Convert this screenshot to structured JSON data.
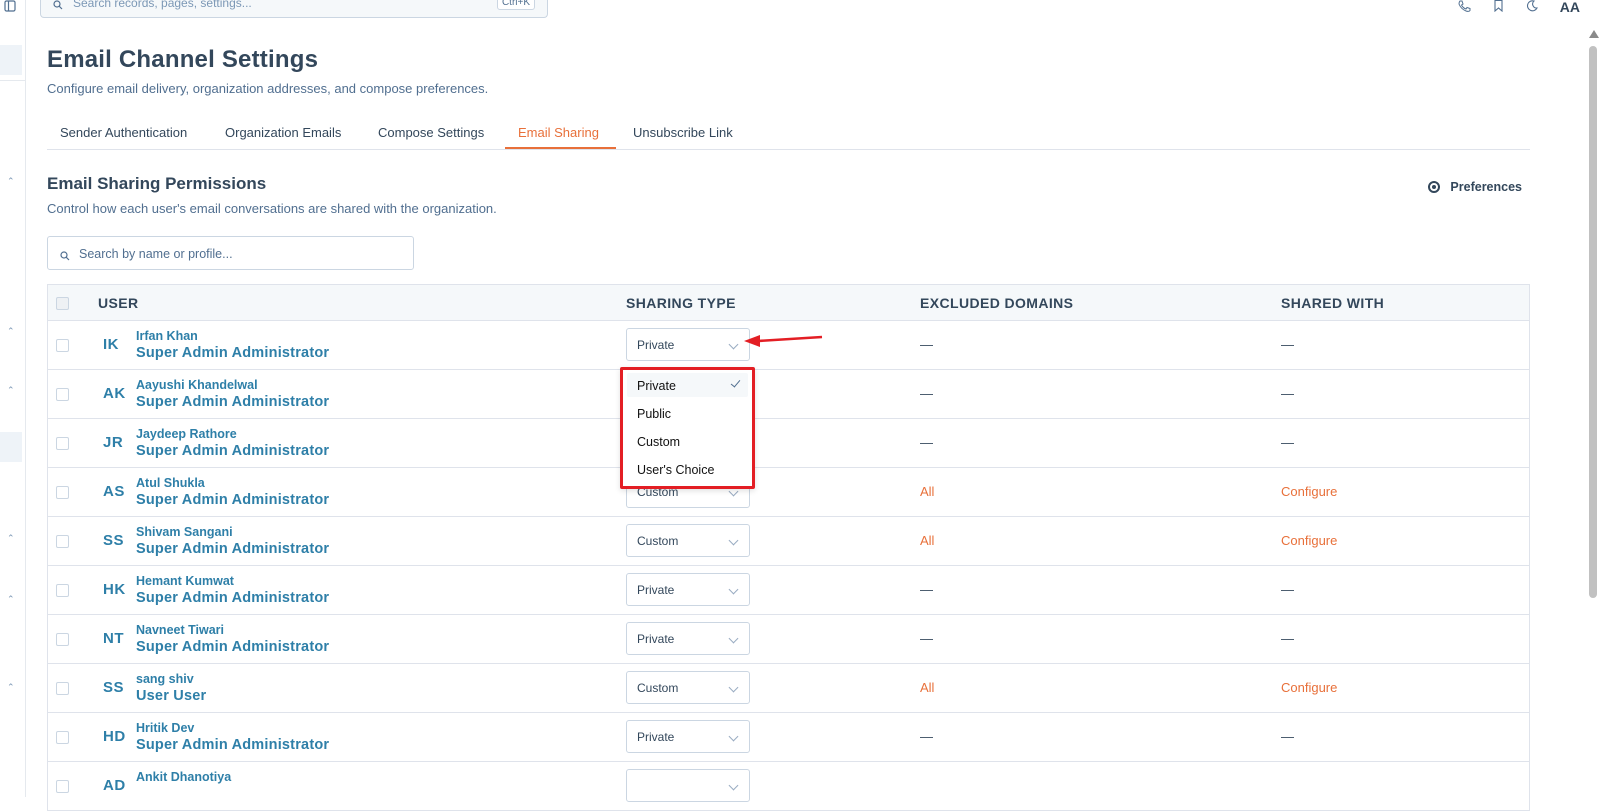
{
  "topbar": {
    "search_placeholder": "Search records, pages, settings...",
    "shortcut": "Ctrl+K",
    "avatar_initials": "AA"
  },
  "page": {
    "title": "Email Channel Settings",
    "subtitle": "Configure email delivery, organization addresses, and compose preferences."
  },
  "tabs": [
    {
      "label": "Sender Authentication"
    },
    {
      "label": "Organization Emails"
    },
    {
      "label": "Compose Settings"
    },
    {
      "label": "Email Sharing",
      "active": true
    },
    {
      "label": "Unsubscribe Link"
    }
  ],
  "section": {
    "title": "Email Sharing Permissions",
    "subtitle": "Control how each user's email conversations are shared with the organization.",
    "preferences_label": "Preferences"
  },
  "filter": {
    "placeholder": "Search by name or profile..."
  },
  "table": {
    "headers": {
      "user": "USER",
      "sharing_type": "SHARING TYPE",
      "excluded_domains": "EXCLUDED DOMAINS",
      "shared_with": "SHARED WITH"
    },
    "rows": [
      {
        "initials": "IK",
        "name": "Irfan Khan",
        "role": "Super Admin Administrator",
        "sharing": "Private",
        "domains": "—",
        "shared": "—"
      },
      {
        "initials": "AK",
        "name": "Aayushi Khandelwal",
        "role": "Super Admin Administrator",
        "sharing": "",
        "domains": "—",
        "shared": "—"
      },
      {
        "initials": "JR",
        "name": "Jaydeep Rathore",
        "role": "Super Admin Administrator",
        "sharing": "",
        "domains": "—",
        "shared": "—"
      },
      {
        "initials": "AS",
        "name": "Atul Shukla",
        "role": "Super Admin Administrator",
        "sharing": "Custom",
        "domains": "All",
        "shared": "Configure"
      },
      {
        "initials": "SS",
        "name": "Shivam Sangani",
        "role": "Super Admin Administrator",
        "sharing": "Custom",
        "domains": "All",
        "shared": "Configure"
      },
      {
        "initials": "HK",
        "name": "Hemant Kumwat",
        "role": "Super Admin Administrator",
        "sharing": "Private",
        "domains": "—",
        "shared": "—"
      },
      {
        "initials": "NT",
        "name": "Navneet Tiwari",
        "role": "Super Admin Administrator",
        "sharing": "Private",
        "domains": "—",
        "shared": "—"
      },
      {
        "initials": "SS",
        "name": "sang shiv",
        "role": "User User",
        "sharing": "Custom",
        "domains": "All",
        "shared": "Configure"
      },
      {
        "initials": "HD",
        "name": "Hritik Dev",
        "role": "Super Admin Administrator",
        "sharing": "Private",
        "domains": "—",
        "shared": "—"
      },
      {
        "initials": "AD",
        "name": "Ankit Dhanotiya",
        "role": "",
        "sharing": "",
        "domains": "",
        "shared": ""
      }
    ]
  },
  "dropdown": {
    "options": [
      "Private",
      "Public",
      "Custom",
      "User's Choice"
    ],
    "selected": "Private"
  },
  "colors": {
    "accent": "#e8703a",
    "link": "#2e7fa8",
    "annotation": "#e31e24"
  }
}
